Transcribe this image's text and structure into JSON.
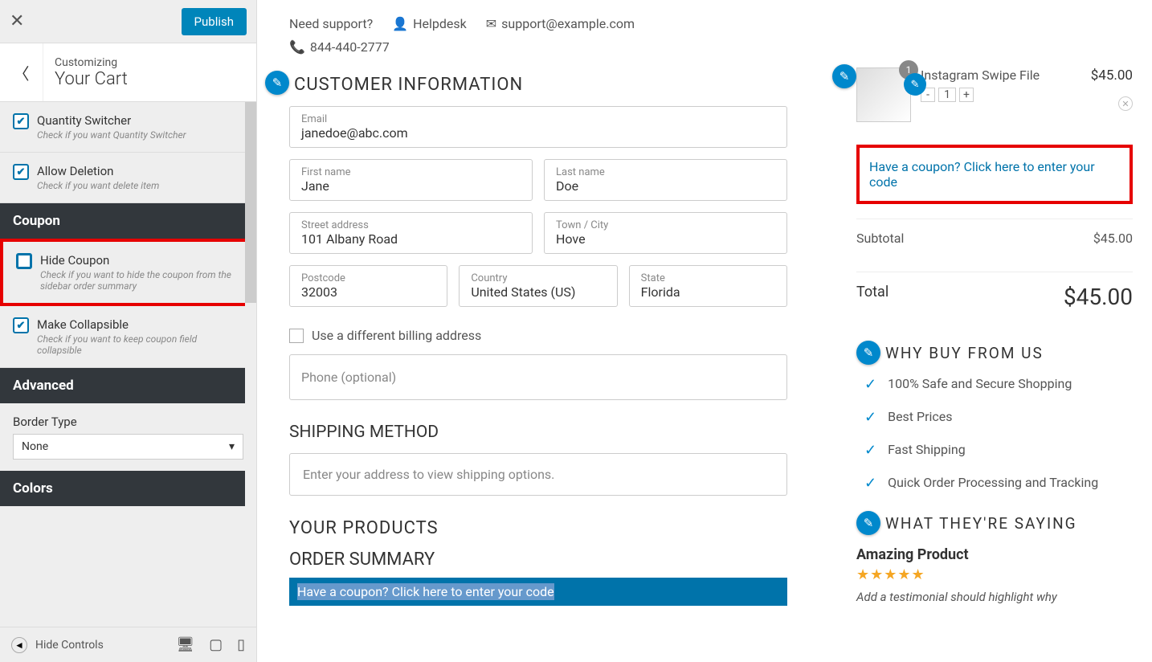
{
  "sidebar": {
    "publish": "Publish",
    "customizing": "Customizing",
    "title": "Your Cart",
    "options": [
      {
        "label": "Quantity Switcher",
        "desc": "Check if you want Quantity Switcher",
        "checked": true
      },
      {
        "label": "Allow Deletion",
        "desc": "Check if you want delete item",
        "checked": true
      }
    ],
    "section_coupon": "Coupon",
    "hide_coupon": {
      "label": "Hide Coupon",
      "desc": "Check if you want to hide the coupon from the sidebar order summary",
      "checked": false
    },
    "make_collapsible": {
      "label": "Make Collapsible",
      "desc": "Check if you want to keep coupon field collapsible",
      "checked": true
    },
    "section_advanced": "Advanced",
    "border_type_label": "Border Type",
    "border_type_value": "None",
    "section_colors": "Colors",
    "hide_controls": "Hide Controls"
  },
  "support": {
    "need": "Need support?",
    "helpdesk": "Helpdesk",
    "email": "support@example.com",
    "phone": "844-440-2777"
  },
  "customer": {
    "heading": "CUSTOMER INFORMATION",
    "email_label": "Email",
    "email": "janedoe@abc.com",
    "first_label": "First name",
    "first": "Jane",
    "last_label": "Last name",
    "last": "Doe",
    "street_label": "Street address",
    "street": "101 Albany Road",
    "town_label": "Town / City",
    "town": "Hove",
    "postcode_label": "Postcode",
    "postcode": "32003",
    "country_label": "Country",
    "country": "United States (US)",
    "state_label": "State",
    "state": "Florida",
    "diff_billing": "Use a different billing address",
    "phone_placeholder": "Phone (optional)"
  },
  "shipping": {
    "heading": "SHIPPING METHOD",
    "msg": "Enter your address to view shipping options."
  },
  "products": {
    "heading": "YOUR PRODUCTS",
    "order_summary": "ORDER SUMMARY",
    "coupon_line": "Have a coupon? Click here to enter your code"
  },
  "cart": {
    "item_name": "Instagram Swipe File",
    "item_qty": "1",
    "item_price": "$45.00",
    "badge": "1",
    "coupon_text": "Have a coupon? Click here to enter your code",
    "subtotal_label": "Subtotal",
    "subtotal": "$45.00",
    "total_label": "Total",
    "total": "$45.00"
  },
  "why": {
    "heading": "WHY BUY FROM US",
    "items": [
      "100% Safe and Secure Shopping",
      "Best Prices",
      "Fast Shipping",
      "Quick Order Processing and Tracking"
    ]
  },
  "saying": {
    "heading": "WHAT THEY'RE SAYING",
    "title": "Amazing Product",
    "stars": "★★★★★",
    "text": "Add a testimonial should highlight why"
  }
}
